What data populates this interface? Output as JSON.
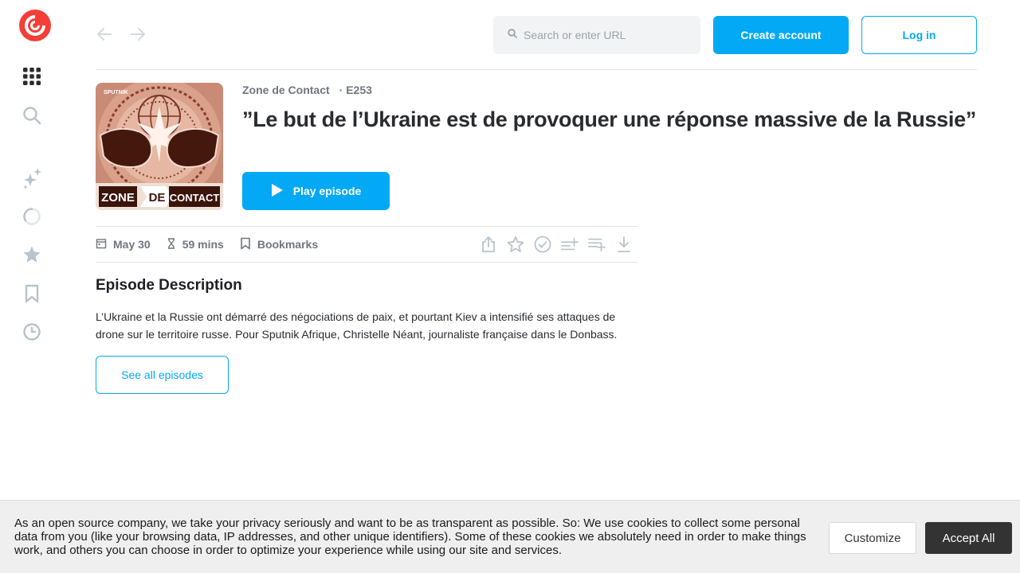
{
  "colors": {
    "accent": "#03a9f4",
    "brand_red": "#f43e37",
    "text_dark": "#292b2f",
    "text_muted": "#6f7580",
    "icon_gray": "#b8c3cb"
  },
  "sidebar": {
    "logo_icon": "pocketcasts-logo-icon",
    "items": [
      {
        "icon": "apps-grid-icon"
      },
      {
        "icon": "search-icon"
      },
      {
        "icon": "sparkles-icon"
      },
      {
        "icon": "in-progress-icon"
      },
      {
        "icon": "star-icon"
      },
      {
        "icon": "bookmark-icon"
      },
      {
        "icon": "history-clock-icon"
      }
    ]
  },
  "topbar": {
    "search_placeholder": "Search or enter URL",
    "create_account_label": "Create account",
    "login_label": "Log in"
  },
  "episode": {
    "artwork": {
      "brand": "SPUTNIK",
      "word1": "ZONE",
      "word2": "DE",
      "word3": "CONTACT"
    },
    "podcast_name": "Zone de Contact",
    "episode_number": "· E253",
    "title": "”Le but de l’Ukraine est de provoquer une réponse massive de la Russie”",
    "play_label": "Play episode",
    "date": "May 30",
    "duration": "59 mins",
    "bookmarks_label": "Bookmarks"
  },
  "description": {
    "heading": "Episode Description",
    "text": "L’Ukraine et la Russie ont démarré des négociations de paix, et pourtant Kiev a intensifié ses attaques de drone sur le territoire russe. Pour Sputnik Afrique, Christelle Néant, journaliste française dans le Donbass.",
    "see_all_label": "See all episodes"
  },
  "cookie_banner": {
    "text": "As an open source company, we take your privacy seriously and want to be as transparent as possible. So: We use cookies to collect some personal data from you (like your browsing data, IP addresses, and other unique identifiers). Some of these cookies we absolutely need in order to make things work, and others you can choose in order to optimize your experience while using our site and services.",
    "customize_label": "Customize",
    "accept_label": "Accept All"
  }
}
